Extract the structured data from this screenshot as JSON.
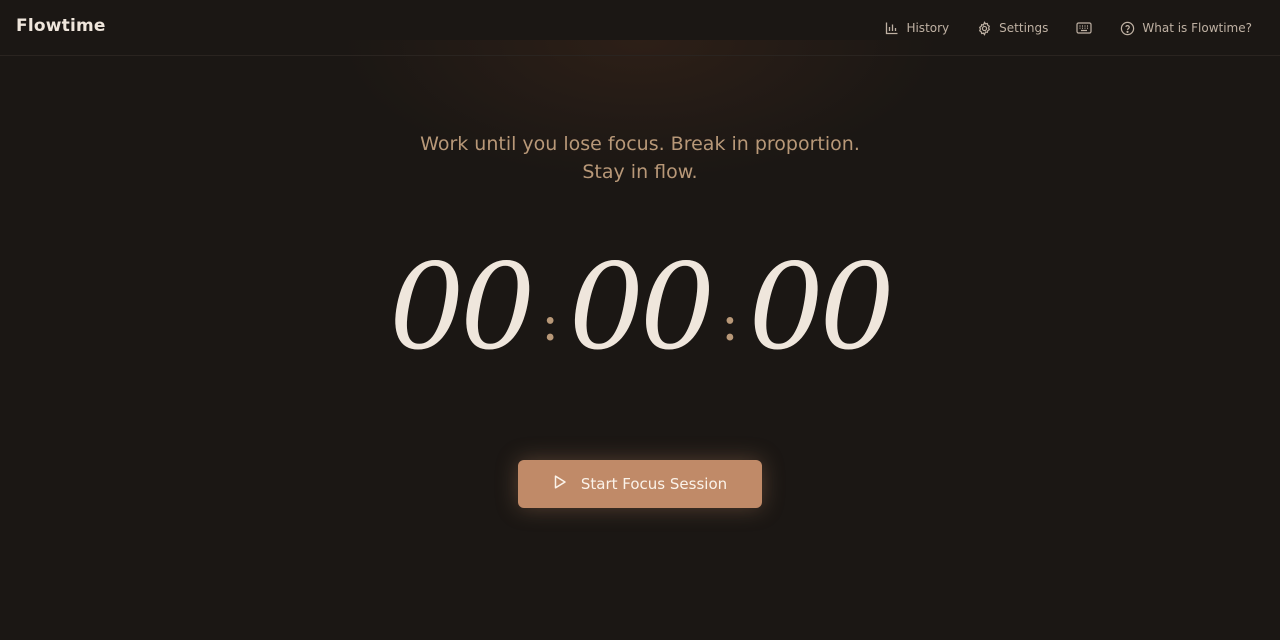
{
  "header": {
    "brand": "Flowtime",
    "nav": {
      "history_label": "History",
      "settings_label": "Settings",
      "help_label": "What is Flowtime?"
    }
  },
  "main": {
    "tagline_line1": "Work until you lose focus. Break in proportion.",
    "tagline_line2": "Stay in flow.",
    "timer": {
      "hours": "00",
      "minutes": "00",
      "seconds": "00",
      "separator": ":"
    },
    "start_button_label": "Start Focus Session"
  },
  "colors": {
    "background": "#1b1714",
    "accent": "#c08a68",
    "text_primary": "#efe6dc",
    "text_muted": "#b89878"
  }
}
